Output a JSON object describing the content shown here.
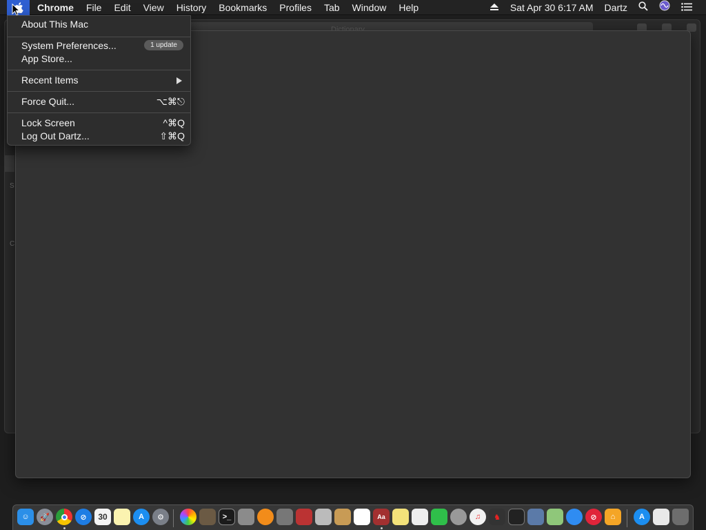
{
  "menubar": {
    "app_name": "Chrome",
    "menus": [
      "File",
      "Edit",
      "View",
      "History",
      "Bookmarks",
      "Profiles",
      "Tab",
      "Window",
      "Help"
    ],
    "datetime": "Sat Apr 30  6:17 AM",
    "user": "Dartz"
  },
  "apple_menu": {
    "about": "About This Mac",
    "system_preferences": "System Preferences...",
    "update_badge": "1 update",
    "app_store": "App Store...",
    "recent_items": "Recent Items",
    "force_quit": "Force Quit...",
    "force_quit_shortcut": "⌥⌘⎋",
    "lock_screen": "Lock Screen",
    "lock_screen_shortcut": "^⌘Q",
    "log_out": "Log Out Dartz...",
    "log_out_shortcut": "⇧⌘Q"
  },
  "background": {
    "window_title": "Dictionary",
    "side_letter_1": "S",
    "side_letter_2": "C"
  },
  "dock": {
    "calendar_day": "30",
    "icons": [
      "finder-icon",
      "launchpad-icon",
      "chrome-icon",
      "safari-icon",
      "calendar-icon",
      "notes-icon",
      "app-store-icon",
      "system-preferences-icon",
      "photos-icon",
      "preview-icon",
      "terminal-icon",
      "script-editor-icon",
      "books-icon",
      "automator-icon",
      "photo-booth-icon",
      "file-icon",
      "contacts-icon",
      "numbers-icon",
      "dictionary-icon",
      "stickies-icon",
      "textedit-icon",
      "facetime-icon",
      "disk-utility-icon",
      "itunes-icon",
      "chess-icon",
      "activity-monitor-icon",
      "image-capture-icon",
      "maps-icon",
      "messages-icon",
      "no-entry-icon",
      "home-icon",
      "app-store-folder-icon",
      "documents-icon",
      "trash-icon"
    ]
  }
}
